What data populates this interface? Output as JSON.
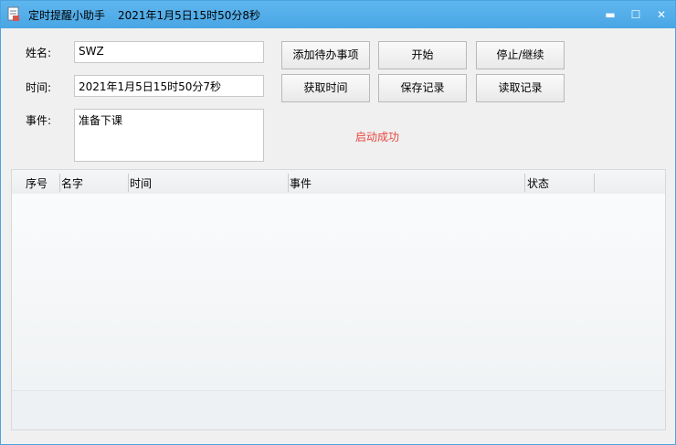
{
  "window": {
    "title": "定时提醒小助手",
    "clock": "2021年1月5日15时50分8秒",
    "minimize_glyph": "▬",
    "maximize_glyph": "☐",
    "close_glyph": "✕"
  },
  "form": {
    "name_label": "姓名:",
    "name_value": "SWZ",
    "time_label": "时间:",
    "time_value": "2021年1月5日15时50分7秒",
    "event_label": "事件:",
    "event_value": "准备下课"
  },
  "buttons": {
    "add": "添加待办事项",
    "start": "开始",
    "pause": "停止/继续",
    "get_time": "获取时间",
    "save": "保存记录",
    "load": "读取记录"
  },
  "status_text": "启动成功",
  "table": {
    "columns": [
      "序号",
      "名字",
      "时间",
      "事件",
      "状态"
    ]
  },
  "colors": {
    "titlebar": "#49a6e4",
    "status": "#e8463f"
  },
  "icons": {
    "app": "document-icon"
  }
}
